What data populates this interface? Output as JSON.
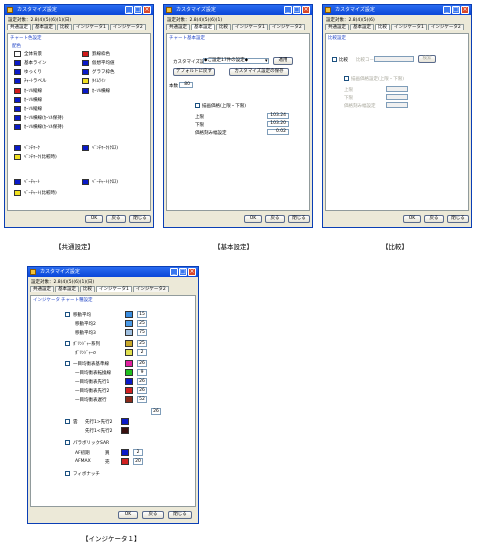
{
  "dialog_title": "カスタマイズ設定",
  "captions": {
    "common": "【共通設定】",
    "basic": "【基本設定】",
    "compare": "【比較】",
    "indicator1": "【インジケータ１】"
  },
  "buttons": {
    "ok": "OK",
    "cancel": "戻る",
    "close": "閉じる"
  },
  "common_dialog": {
    "subtitle": "設定対象：2.8(4)(5)(6)(1)(日)",
    "tabs": [
      "共通設定",
      "基本設定",
      "比較",
      "インジケータ1",
      "インジケータ2"
    ],
    "link": "チャート色設定",
    "section": "配色",
    "items": [
      {
        "label": "全体背景",
        "color": "#ffffff"
      },
      {
        "label": "罫線枠色",
        "color": "#d01a1a"
      },
      {
        "label": "基本ライン",
        "color": "#0a1ac8"
      },
      {
        "label": "仮想平均値",
        "color": "#0a1ac8"
      },
      {
        "label": "ゆっくり",
        "color": "#0a1ac8"
      },
      {
        "label": "グラフ枠色",
        "color": "#0a1ac8"
      },
      {
        "label": "ﾁｬｰﾄラベル",
        "color": "#0a1ac8"
      },
      {
        "label": "ﾀｲﾑﾗｲﾝ",
        "color": "#f0e020"
      },
      {
        "label": "ｶｰｿﾙ縦線",
        "color": "#d01a1a"
      },
      {
        "label": "ｶｰｿﾙ横線",
        "color": "#0a1ac8"
      },
      {
        "label": "ｶｰｿﾙ横線",
        "color": "#0a1ac8"
      },
      {
        "label": "ｶｰｿﾙ縦線",
        "color": "#0a1ac8"
      },
      {
        "label": "ｶｰｿﾙ横線(ｶｰｿﾙ保持)",
        "color": "#0a1ac8"
      },
      {
        "label": "ｶｰｿﾙ横線(ｶｰｿﾙ保持)",
        "color": "#0a1ac8"
      },
      {
        "label": "ﾍﾞﾝﾁﾏｰｸ",
        "color": "#0a1ac8"
      },
      {
        "label": "ﾍﾞﾝﾁﾏｰｸ(ｸﾛｽ)",
        "color": "#0a1ac8"
      },
      {
        "label": "ﾍﾞﾝﾁﾏｰｸ(比較時)",
        "color": "#f0e020"
      },
      {
        "label": "ﾍﾞｰﾁｬｰﾄ",
        "color": "#0a1ac8"
      },
      {
        "label": "ﾍﾞｰﾁｬｰﾄ(ｸﾛｽ)",
        "color": "#0a1ac8"
      },
      {
        "label": "ﾍﾞｰﾁｬｰﾄ(比較時)",
        "color": "#f0e020"
      }
    ]
  },
  "basic_dialog": {
    "subtitle": "設定対象：2.8(4)(5)(6)(1)",
    "tabs": [
      "共通設定",
      "基本設定",
      "比較",
      "インジケータ1",
      "インジケータ2"
    ],
    "link": "チャート基本設定",
    "custom_label": "カスタマイズ設定",
    "custom_value": "◆ご設定17件の設定◆",
    "apply_button": "適用",
    "btn_default": "デフォルトに戻す",
    "btn_save": "カスタマイズ設定の保存",
    "period_label": "本数",
    "period_value": "80",
    "range_check": "描画価格(上限・下限)",
    "upper_label": "上限",
    "upper_value": "103.24",
    "lower_label": "下限",
    "lower_value": "103.20",
    "tick_label": "価格刻み幅設定",
    "tick_value": "0.02"
  },
  "compare_dialog": {
    "subtitle": "設定対象：2.8(4)(5)(6)",
    "tabs": [
      "共通設定",
      "基本設定",
      "比較",
      "インジケータ1",
      "インジケータ2"
    ],
    "link": "比較設定",
    "check": "比較",
    "code_label": "比較コード",
    "search": "検索",
    "range_check": "描画価格設定(上限・下限)",
    "upper_label": "上限",
    "lower_label": "下限",
    "tick_label": "価格刻み幅設定"
  },
  "ind_dialog": {
    "subtitle": "設定対象：2.8(4)(5)(6)(1)(日)",
    "tabs": [
      "共通設定",
      "基本設定",
      "比較",
      "インジケータ1",
      "インジケータ2"
    ],
    "link1": "インジケータ",
    "link2": "チャート種設定",
    "rows": [
      {
        "check": true,
        "label": "移動平均",
        "sub": "移動平均1",
        "color": "#3a8de0",
        "num": "15"
      },
      {
        "check": false,
        "label": "",
        "sub": "移動平均2",
        "color": "#4a9ae8",
        "num": "25"
      },
      {
        "check": false,
        "label": "",
        "sub": "移動平均3",
        "color": "#a0c0e0",
        "num": "75"
      },
      {
        "check": true,
        "label": "ﾎﾞﾘﾝｼﾞｬｰ系列",
        "sub": "",
        "color": "#c8a82a",
        "num": "25"
      },
      {
        "check": false,
        "label": "",
        "sub": "ﾎﾞﾘﾝｼﾞｬｰσ",
        "color": "#e0e050",
        "num": "2"
      },
      {
        "check": true,
        "label": "一目均衡表基準線",
        "sub": "",
        "color": "#e020a0",
        "num": "26"
      },
      {
        "check": false,
        "label": "",
        "sub": "一目均衡表転換線",
        "color": "#20c020",
        "num": "9"
      },
      {
        "check": false,
        "label": "",
        "sub": "一目均衡表先行1",
        "color": "#0a1ac8",
        "num": "26"
      },
      {
        "check": false,
        "label": "",
        "sub": "一目均衡表先行2",
        "color": "#d02020",
        "num": "26"
      },
      {
        "check": false,
        "label": "",
        "sub": "一目均衡表遅行",
        "color": "#8a2a1a",
        "num": "52"
      }
    ],
    "last_num2": "26",
    "cloud_label": "雲",
    "cloud_up": "先行1>先行2",
    "cloud_down": "先行1<先行2",
    "cloud_up_color": "#0a1ac8",
    "cloud_down_color": "#3a1010",
    "parabolic_label": "パラボリックSAR",
    "af_label": "AF初期",
    "af_sub": "買",
    "af_color": "#0a1ac8",
    "af_num": "2",
    "afmax_label": "AFMAX",
    "afmax_sub": "売",
    "afmax_color": "#d02020",
    "afmax_num": "20",
    "fib_label": "フィボナッチ"
  }
}
